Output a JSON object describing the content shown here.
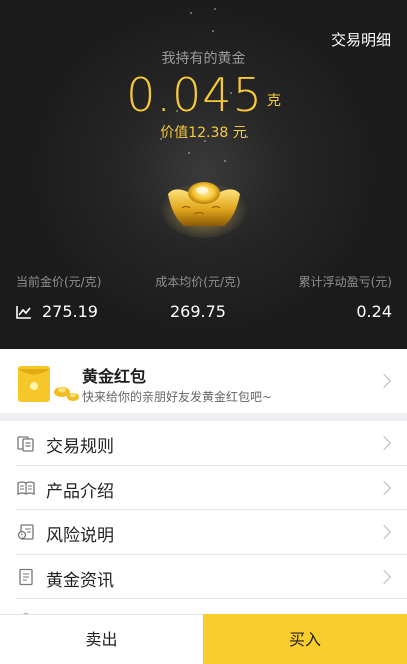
{
  "header": {
    "trade_detail_link": "交易明细"
  },
  "holding": {
    "label": "我持有的黄金",
    "amount": "0.045",
    "unit": "克",
    "value_text": "价值12.38 元"
  },
  "stats": [
    {
      "label": "当前金价(元/克)",
      "value": "275.19"
    },
    {
      "label": "成本均价(元/克)",
      "value": "269.75"
    },
    {
      "label": "累计浮动盈亏(元)",
      "value": "0.24"
    }
  ],
  "red_packet": {
    "title": "黄金红包",
    "subtitle": "快来给你的亲朋好友发黄金红包吧~"
  },
  "menu": [
    {
      "label": "交易规则",
      "icon": "rules-icon"
    },
    {
      "label": "产品介绍",
      "icon": "book-icon"
    },
    {
      "label": "风险说明",
      "icon": "risk-icon"
    },
    {
      "label": "黄金资讯",
      "icon": "news-icon"
    }
  ],
  "actions": {
    "sell": "卖出",
    "buy": "买入"
  },
  "colors": {
    "gold_accent": "#f7c93a",
    "buy_button": "#f9cd2e",
    "hero_background": "#1f1f1f"
  }
}
